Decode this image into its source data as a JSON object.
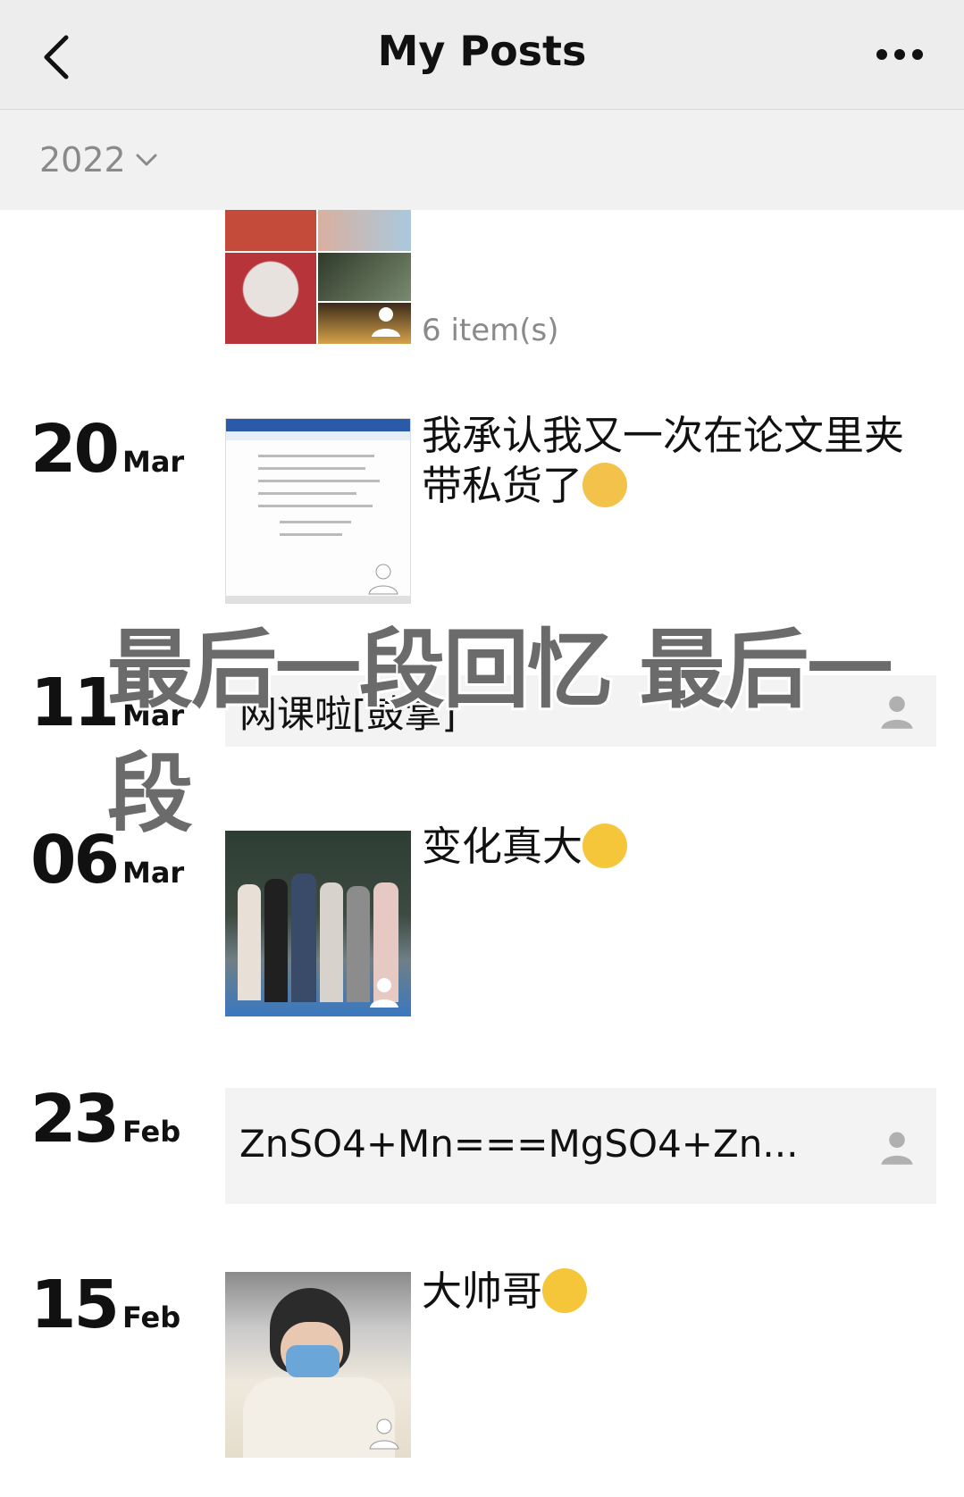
{
  "header": {
    "title": "My Posts",
    "back_icon": "chevron-left-icon",
    "more_icon": "ellipsis-icon"
  },
  "filter": {
    "year": "2022",
    "chevron_icon": "chevron-down-icon"
  },
  "posts": [
    {
      "day": "",
      "month": "",
      "type": "grid",
      "count_text": "6 item(s)"
    },
    {
      "day": "20",
      "month": "Mar",
      "type": "image",
      "caption": "我承认我又一次在论文里夹带私货了",
      "emoji": "cool-cat-emoji"
    },
    {
      "day": "11",
      "month": "Mar",
      "type": "text",
      "text": "网课啦[鼓掌]"
    },
    {
      "day": "06",
      "month": "Mar",
      "type": "image",
      "caption": "变化真大",
      "emoji": "thinking-emoji"
    },
    {
      "day": "23",
      "month": "Feb",
      "type": "text",
      "text": "ZnSO4+Mn===MgSO4+Zn..."
    },
    {
      "day": "15",
      "month": "Feb",
      "type": "image",
      "caption": "大帅哥",
      "emoji": "heart-eyes-emoji"
    }
  ],
  "overlay_caption": "最后一段回忆 最后一段",
  "colors": {
    "header_bg": "#ededed",
    "card_bg": "#f3f3f3",
    "muted": "#8a8a8a"
  }
}
